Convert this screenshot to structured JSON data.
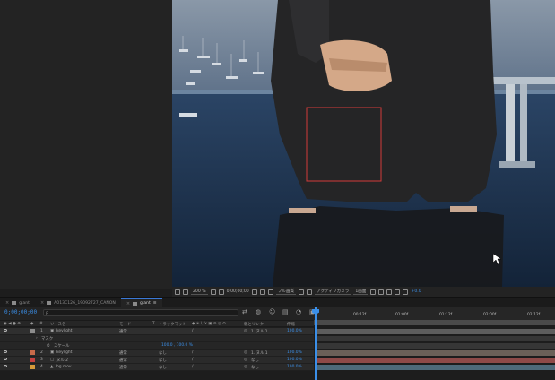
{
  "viewer": {
    "zoom": "200 %",
    "timecode": "0;00;00;00",
    "resolution": "フル画質",
    "camera": "アクティブカメラ",
    "views": "1画面",
    "exposure": "+0.0"
  },
  "tabs": [
    {
      "label": "giant",
      "color": "#8a8a8a",
      "active": false
    },
    {
      "label": "A013C126_19092727_CANON",
      "color": "#8a8a8a",
      "active": false
    },
    {
      "label": "giant",
      "color": "#8a8a8a",
      "active": true
    }
  ],
  "timeline": {
    "timecode": "0;00;00;00",
    "search_placeholder": "ρ",
    "columns": {
      "source_name": "ソース名",
      "mode": "モード",
      "t": "T",
      "track_matte": "トラックマット",
      "switches": "◆ ✳ \\ fx ▣ ⊘ ◎ ⊙",
      "parent": "親とリンク",
      "stretch": "伸縮"
    },
    "ruler_labels": [
      "00:12f",
      "01:00f",
      "01:12f",
      "02:00f",
      "02:12f"
    ]
  },
  "layers": [
    {
      "num": "1",
      "name": "keylight",
      "mode": "通常",
      "matte": "",
      "parent": "1. ヌル 1",
      "stretch": "100.0%",
      "color": "#8c8c8c",
      "bar": "#5d5d5d"
    },
    {
      "num": "",
      "name": "マスク",
      "mode": "",
      "matte": "",
      "parent": "",
      "stretch": "",
      "color": "",
      "bar": "#363636"
    },
    {
      "num": "",
      "name": "スケール",
      "mode": "",
      "matte": "",
      "parent": "",
      "stretch": "",
      "color": "",
      "bar": "#363636",
      "value": "100.0 , 100.0 %"
    },
    {
      "num": "2",
      "name": "keylight",
      "mode": "通常",
      "matte": "なし",
      "parent": "1. ヌル 1",
      "stretch": "100.0%",
      "color": "#c76a4a",
      "bar": "#6b6058"
    },
    {
      "num": "3",
      "name": "ヌル 2",
      "mode": "通常",
      "matte": "なし",
      "parent": "なし",
      "stretch": "100.0%",
      "color": "#c44040",
      "bar": "#8e4a48"
    },
    {
      "num": "4",
      "name": "bg.mov",
      "mode": "通常",
      "matte": "なし",
      "parent": "なし",
      "stretch": "100.0%",
      "color": "#d69a3a",
      "bar": "#4e6a7a"
    }
  ],
  "colors": {
    "accent": "#3b8fe8",
    "selection_box": "#d43a3a"
  }
}
